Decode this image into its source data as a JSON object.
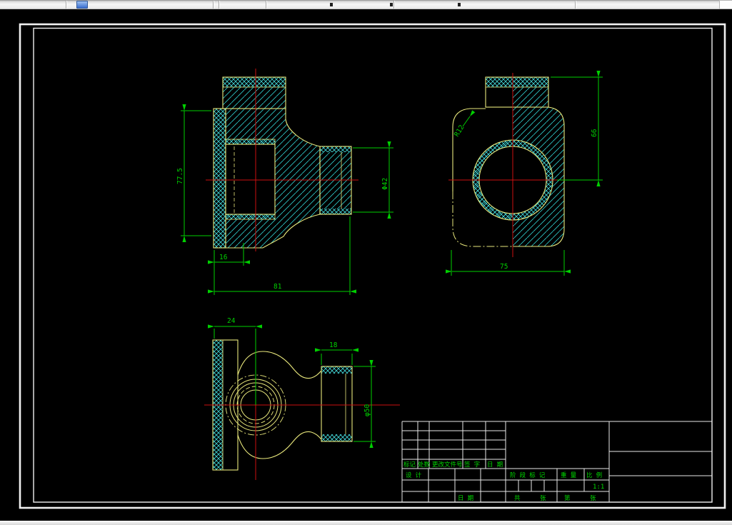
{
  "window": {
    "toolbar": {
      "app_icon": "application-icon"
    }
  },
  "drawing": {
    "views": {
      "front_section": {
        "dim_height": "77.5",
        "dim_flange_dia": "Φ42",
        "dim_step_width": "16",
        "dim_total_width": "81"
      },
      "side": {
        "dim_fillet": "R12",
        "dim_height": "66",
        "dim_width": "75"
      },
      "top": {
        "dim_boss_width": "24",
        "dim_flange_width": "18",
        "dim_flange_dia": "φ50"
      }
    },
    "title_block": {
      "rev_col_mark": "标记",
      "rev_col_count": "处数",
      "rev_col_file": "更改文件号",
      "rev_col_sign": "签 字",
      "rev_col_date": "日 期",
      "design_label": "设 计",
      "date_label": "日 期",
      "stage_label": "阶 段 标 记",
      "weight_label": "重 量",
      "scale_label": "比 例",
      "scale_value": "1:1",
      "sheets_total_label": "共",
      "sheets_unit_label": "张",
      "sheet_no_label": "第",
      "sheet_no_unit_label": "张"
    },
    "colors": {
      "outline": "#e9e87c",
      "hatch": "#2ec6c6",
      "dimension": "#00cf00",
      "centerline": "#cc1111",
      "frame": "#f0f0f0"
    }
  }
}
